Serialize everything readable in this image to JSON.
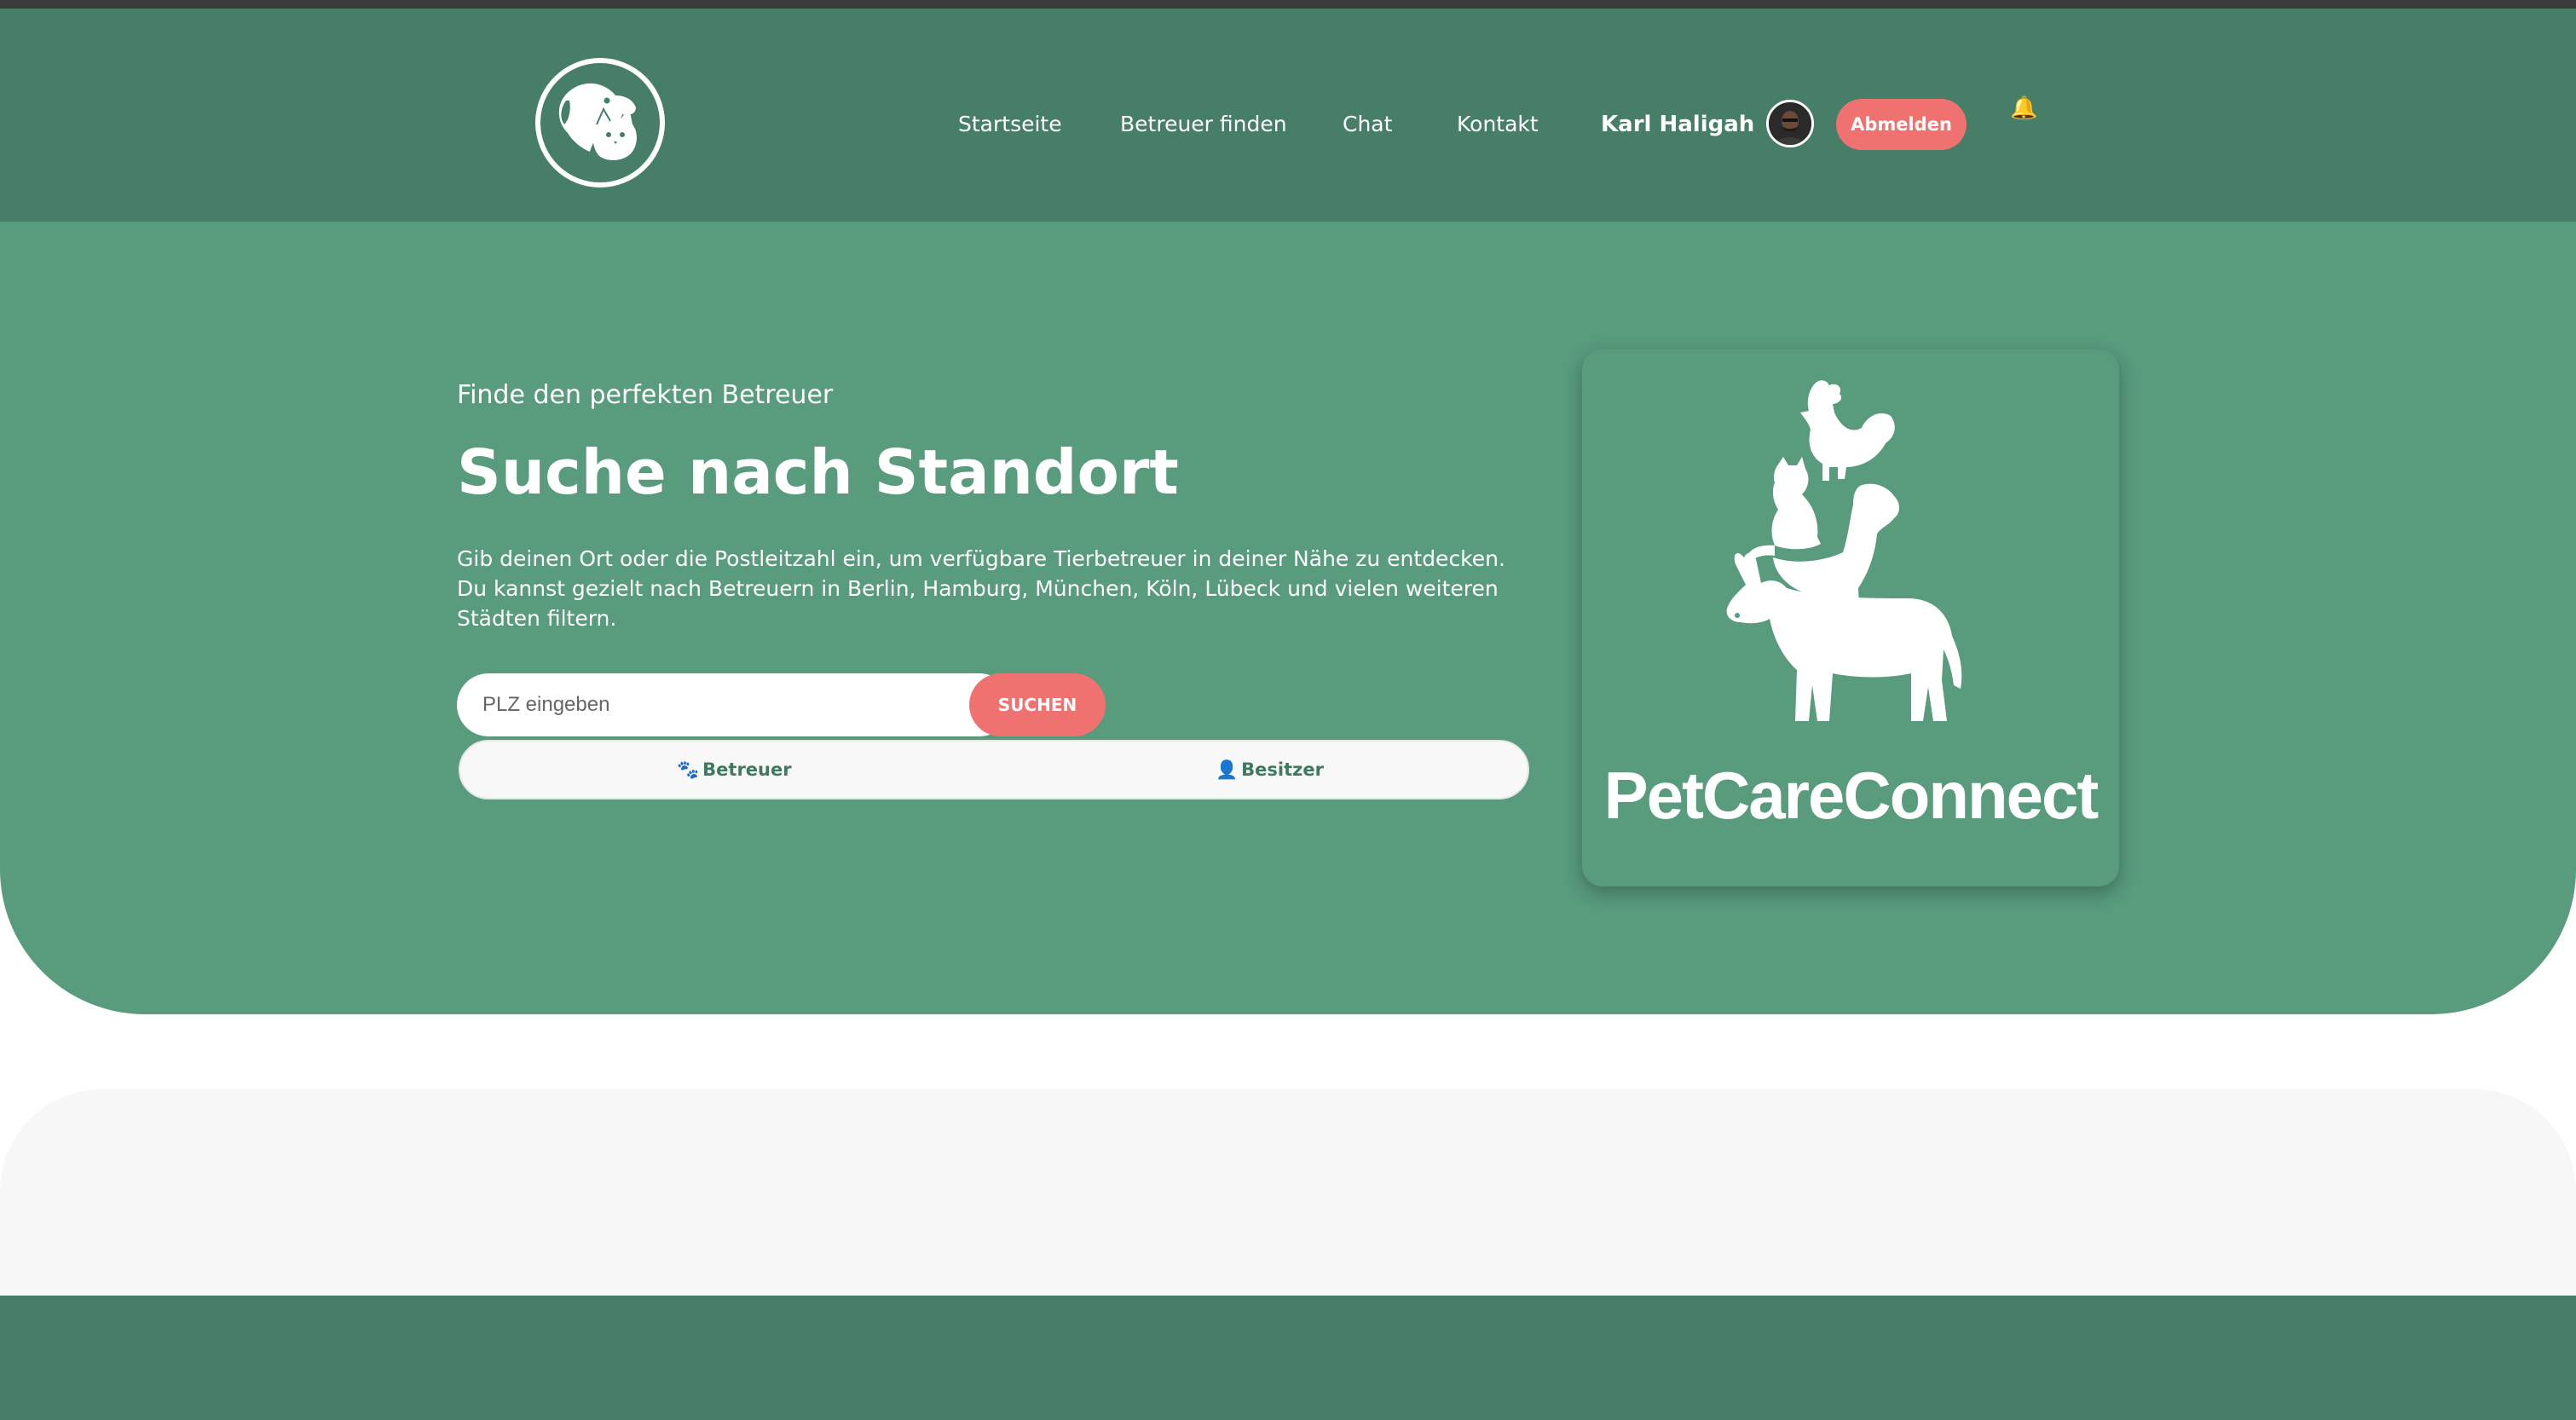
{
  "nav": {
    "links": [
      "Startseite",
      "Betreuer finden",
      "Chat",
      "Kontakt"
    ],
    "user_name": "Karl Haligah",
    "logout_label": "Abmelden",
    "bell_icon": "🔔"
  },
  "hero": {
    "subtitle": "Finde den perfekten Betreuer",
    "title": "Suche nach Standort",
    "description": "Gib deinen Ort oder die Postleitzahl ein, um verfügbare Tierbetreuer in deiner Nähe zu entdecken. Du kannst gezielt nach Betreuern in Berlin, Hamburg, München, Köln, Lübeck und vielen weiteren Städten filtern.",
    "search_placeholder": "PLZ eingeben",
    "search_button": "SUCHEN",
    "roles": [
      {
        "glyph": "🐾",
        "label": "Betreuer"
      },
      {
        "glyph": "👤",
        "label": "Besitzer"
      }
    ]
  },
  "brand": {
    "name": "PetCareConnect"
  },
  "colors": {
    "header": "#477e67",
    "hero": "#589b7d",
    "accent": "#ef7270"
  }
}
